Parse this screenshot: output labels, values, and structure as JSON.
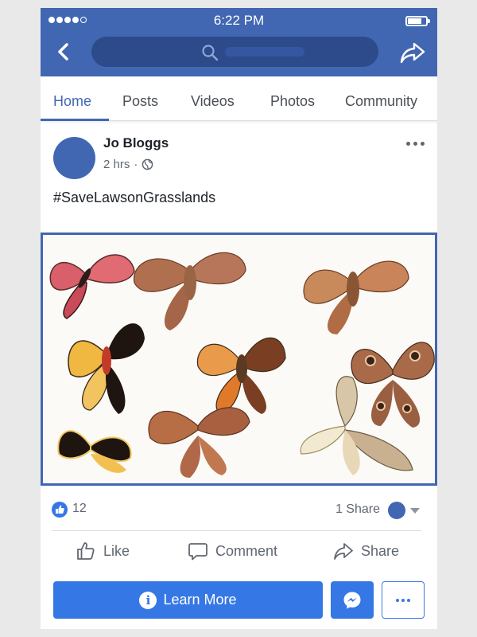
{
  "status_bar": {
    "time": "6:22 PM"
  },
  "tabs": [
    {
      "label": "Home",
      "active": true
    },
    {
      "label": "Posts",
      "active": false
    },
    {
      "label": "Videos",
      "active": false
    },
    {
      "label": "Photos",
      "active": false
    },
    {
      "label": "Community",
      "active": false
    }
  ],
  "post": {
    "author": "Jo Bloggs",
    "time": "2 hrs",
    "separator": "·",
    "text": "#SaveLawsonGrasslands",
    "image_subject": "moths-illustration"
  },
  "engagement": {
    "likes": "12",
    "shares": "1 Share"
  },
  "actions": {
    "like": "Like",
    "comment": "Comment",
    "share": "Share"
  },
  "cta": {
    "learn_more": "Learn More"
  },
  "colors": {
    "brand": "#4267b2",
    "accent": "#3578e5",
    "text_muted": "#606770"
  }
}
